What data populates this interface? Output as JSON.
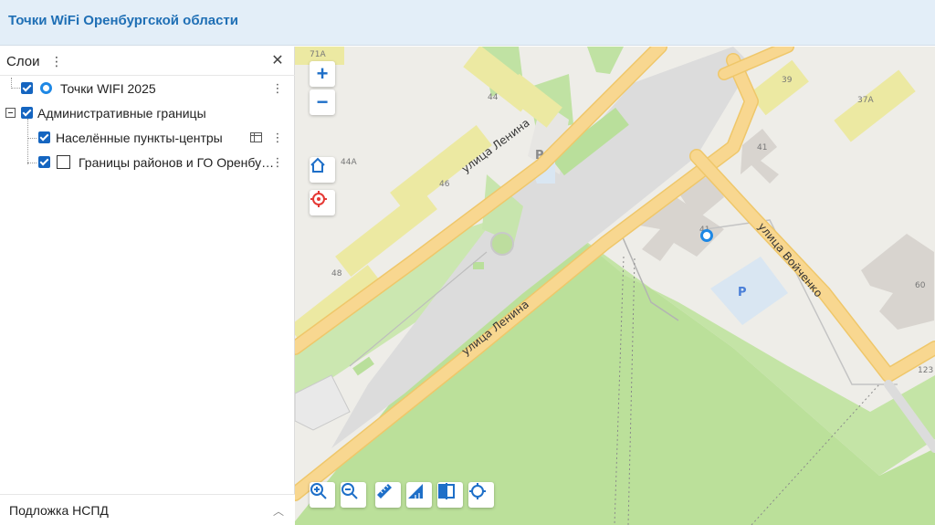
{
  "header": {
    "title": "Точки WiFi Оренбургской области"
  },
  "sidebar": {
    "title": "Слои",
    "menu_icon": "more-vert-icon",
    "close_icon": "close-icon",
    "layers": [
      {
        "label": "Точки WIFI 2025",
        "checked": true,
        "icon": "ring-marker-icon"
      },
      {
        "label": "Административные границы",
        "checked": true,
        "expanded": true
      },
      {
        "label": "Населённые пункты-центры",
        "checked": true,
        "icon": "table-icon"
      },
      {
        "label": "Границы районов и ГО Оренбу…",
        "checked": true,
        "icon": "square-outline-icon"
      }
    ],
    "basemap": {
      "label": "Подложка НСПД",
      "icon": "chevron-up-icon"
    }
  },
  "map": {
    "streets": [
      "улица Ленина",
      "улица Ленина",
      "улица Войченко"
    ],
    "house_numbers": [
      "71А",
      "44",
      "39",
      "37А",
      "41",
      "44А",
      "46",
      "48",
      "60",
      "123",
      "41"
    ],
    "parking_label": "P",
    "colors": {
      "road": "#f8d790",
      "road_edge": "#efc76a",
      "building": "#d8d4cf",
      "green": "#c0e2a3",
      "park": "#bbe09a",
      "parking": "#d9e6f2",
      "accent": "#1e6fc8"
    },
    "controls": {
      "zoom_in": "+",
      "zoom_out": "−",
      "home_icon": "home-icon",
      "locate_icon": "target-icon",
      "toolbar": [
        "zoom-in-icon",
        "zoom-out-icon",
        "ruler-icon",
        "area-measure-icon",
        "compare-icon",
        "crosshair-icon"
      ]
    }
  }
}
